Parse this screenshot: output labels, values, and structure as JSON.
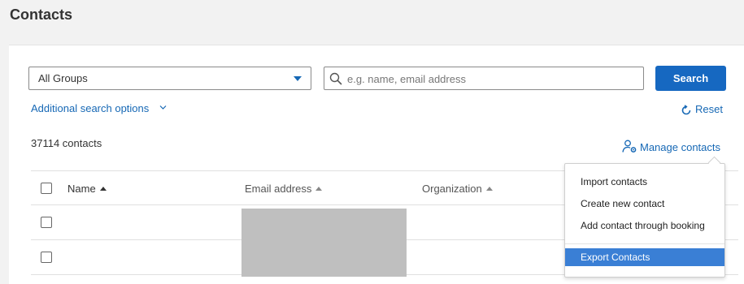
{
  "page": {
    "title": "Contacts"
  },
  "filters": {
    "group_select": {
      "value": "All Groups"
    },
    "search": {
      "placeholder": "e.g. name, email address",
      "value": ""
    },
    "search_button_label": "Search",
    "additional_options_label": "Additional search options",
    "reset_label": "Reset"
  },
  "summary": {
    "count_label": "37114 contacts"
  },
  "manage": {
    "label": "Manage contacts"
  },
  "table": {
    "columns": [
      {
        "label": "Name"
      },
      {
        "label": "Email address"
      },
      {
        "label": "Organization"
      }
    ],
    "rows": [
      {
        "name": "",
        "email": "",
        "organization": ""
      },
      {
        "name": "",
        "email": "",
        "organization": ""
      }
    ]
  },
  "manage_menu": {
    "items": [
      {
        "label": "Import contacts"
      },
      {
        "label": "Create new contact"
      },
      {
        "label": "Add contact through booking"
      },
      {
        "label": "Export Contacts",
        "highlighted": true
      }
    ]
  },
  "colors": {
    "accent": "#1668c1",
    "link": "#1668b5",
    "highlight": "#3a7fd5"
  }
}
